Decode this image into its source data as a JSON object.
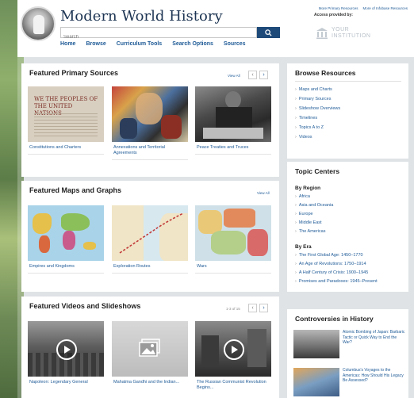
{
  "header": {
    "title": "Modern World History",
    "search_placeholder": "Search",
    "top_links": [
      "More Primary Resources",
      "More of Infobase Resources"
    ],
    "access_label": "Access provided by:",
    "institution_text": [
      "YOUR",
      "INSTITUTION"
    ],
    "nav": [
      "Home",
      "Browse",
      "Curriculum Tools",
      "Search Options",
      "Sources"
    ]
  },
  "primary_sources": {
    "title": "Featured Primary Sources",
    "view_all": "View All",
    "cards": [
      {
        "caption": "Constitutions and Charters",
        "thumb_text": "WE THE PEOPLES OF THE UNITED NATIONS"
      },
      {
        "caption": "Annexations and Territorial Agreements"
      },
      {
        "caption": "Peace Treaties and Truces"
      }
    ]
  },
  "maps": {
    "title": "Featured Maps and Graphs",
    "view_all": "View All",
    "cards": [
      {
        "caption": "Empires and Kingdoms"
      },
      {
        "caption": "Exploration Routes"
      },
      {
        "caption": "Wars"
      }
    ]
  },
  "videos": {
    "title": "Featured Videos and Slideshows",
    "pager_text": "1-3 of 15",
    "cards": [
      {
        "caption": "Napoleon: Legendary General"
      },
      {
        "caption": "Mahatma Gandhi and the Indian..."
      },
      {
        "caption": "The Russian Communist Revolution Begins..."
      }
    ]
  },
  "browse": {
    "title": "Browse Resources",
    "items": [
      "Maps and Charts",
      "Primary Sources",
      "Slideshow Overviews",
      "Timelines",
      "Topics A to Z",
      "Videos"
    ]
  },
  "topics": {
    "title": "Topic Centers",
    "by_region": "By Region",
    "regions": [
      "Africa",
      "Asia and Oceania",
      "Europe",
      "Middle East",
      "The Americas"
    ],
    "by_era": "By Era",
    "eras": [
      "The First Global Age: 1450–1770",
      "An Age of Revolutions: 1750–1914",
      "A Half Century of Crisis: 1900–1945",
      "Promises and Paradoxes: 1945–Present"
    ]
  },
  "controversies": {
    "title": "Controversies in History",
    "items": [
      {
        "text": "Atomic Bombing of Japan: Barbaric Tactic or Quick Way to End the War?"
      },
      {
        "text": "Columbus's Voyages to the Americas: How Should His Legacy Be Assessed?"
      }
    ]
  }
}
